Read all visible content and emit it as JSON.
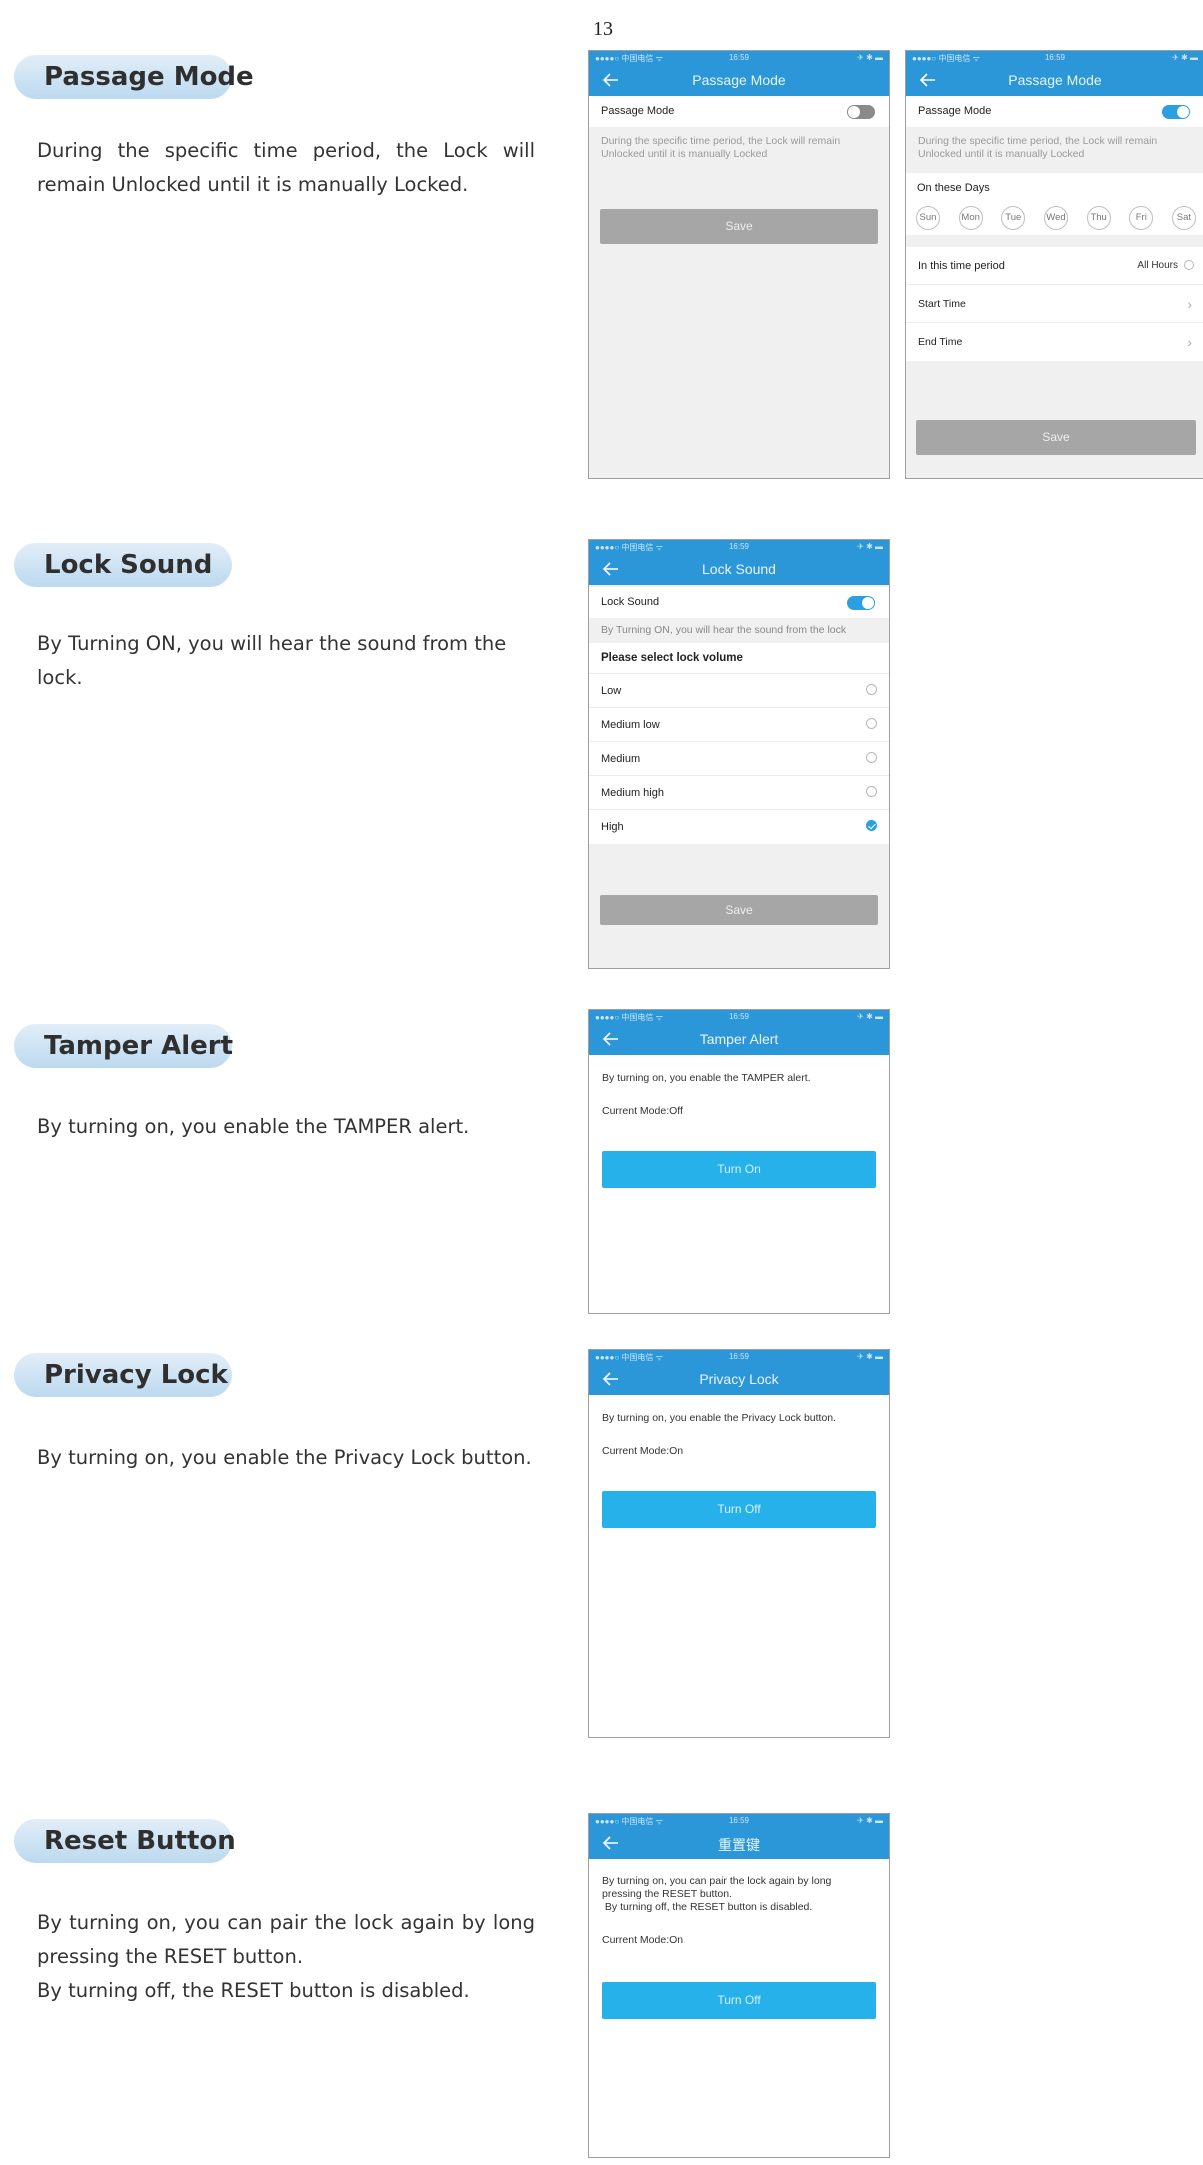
{
  "page_number": "13",
  "status": {
    "carrier": "●●●●○ 中国电信 ᯤ",
    "time": "16:59",
    "right": "✈ ✱ ▬"
  },
  "sections": {
    "passage": {
      "title": "Passage Mode",
      "desc": "During the specific time period, the Lock will remain Unlocked until it is manually Locked.",
      "screen1": {
        "nav_title": "Passage Mode",
        "row_label": "Passage Mode",
        "toggle_state": "off",
        "hint": "During the specific time period, the Lock will remain Unlocked until it is manually Locked",
        "save": "Save"
      },
      "screen2": {
        "nav_title": "Passage Mode",
        "row_label": "Passage Mode",
        "toggle_state": "on",
        "hint": "During the specific time period, the Lock will remain Unlocked until it is manually Locked",
        "days_label": "On these Days",
        "days": [
          "Sun",
          "Mon",
          "Tue",
          "Wed",
          "Thu",
          "Fri",
          "Sat"
        ],
        "period_label": "In this time period",
        "period_value": "All Hours",
        "start_time": "Start Time",
        "end_time": "End Time",
        "save": "Save"
      }
    },
    "lock_sound": {
      "title": "Lock Sound",
      "desc": "By Turning ON, you will hear the sound from the lock.",
      "screen": {
        "nav_title": "Lock Sound",
        "row_label": "Lock Sound",
        "toggle_state": "on",
        "hint": "By Turning ON, you will hear the sound from the lock",
        "select_label": "Please select lock volume",
        "options": [
          "Low",
          "Medium low",
          "Medium",
          "Medium high",
          "High"
        ],
        "selected": "High",
        "save": "Save"
      }
    },
    "tamper": {
      "title": "Tamper Alert",
      "desc": "By turning on, you enable the TAMPER alert.",
      "screen": {
        "nav_title": "Tamper Alert",
        "text": "By turning on, you enable the TAMPER alert.",
        "mode": "Current Mode:Off",
        "button": "Turn On"
      }
    },
    "privacy": {
      "title": "Privacy Lock",
      "desc": "By turning on, you enable the Privacy Lock button.",
      "screen": {
        "nav_title": "Privacy Lock",
        "text": "By turning on, you enable the Privacy Lock button.",
        "mode": "Current Mode:On",
        "button": "Turn Off"
      }
    },
    "reset": {
      "title": "Reset Button",
      "desc_line1": "By turning on, you can pair the lock again by long pressing the RESET button.",
      "desc_line2": "By turning off, the RESET button is disabled.",
      "screen": {
        "nav_title": "重置键",
        "text_line1": "By turning on, you can pair the lock again by long pressing the RESET button.",
        "text_line2": " By turning off, the RESET button is disabled.",
        "mode": "Current Mode:On",
        "button": "Turn Off"
      }
    }
  },
  "colors": {
    "nav": "#2b96d8",
    "accent_button": "#27b1ea",
    "disabled_button": "#a6a6a6",
    "title_pill": "#bcd9ef"
  },
  "icons": {
    "back": "arrow-left-icon",
    "chevron": "chevron-right-icon"
  }
}
